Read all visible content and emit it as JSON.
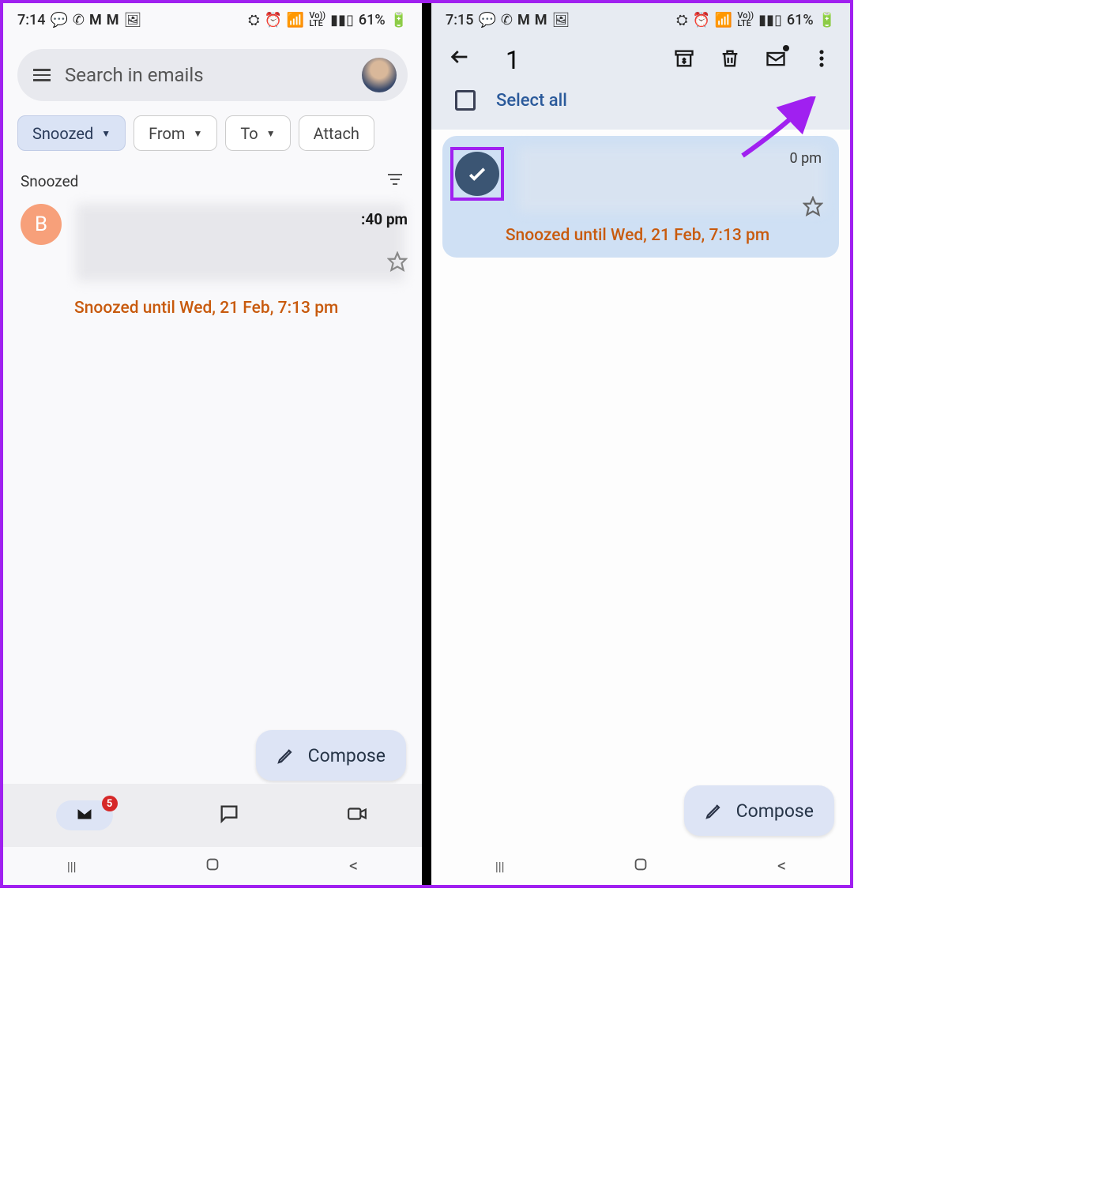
{
  "left": {
    "status": {
      "time": "7:14",
      "battery": "61%",
      "net": "Vo))\nLTE"
    },
    "search_placeholder": "Search in emails",
    "chips": {
      "snoozed": "Snoozed",
      "from": "From",
      "to": "To",
      "attachment": "Attach"
    },
    "section_label": "Snoozed",
    "email": {
      "avatar_letter": "B",
      "time": ":40 pm",
      "snooze_text": "Snoozed until Wed, 21 Feb, 7:13 pm"
    },
    "compose": "Compose",
    "badge": "5"
  },
  "right": {
    "status": {
      "time": "7:15",
      "battery": "61%",
      "net": "Vo))\nLTE"
    },
    "selected_count": "1",
    "select_all": "Select all",
    "email": {
      "time": "0 pm",
      "snooze_text": "Snoozed until Wed, 21 Feb, 7:13 pm"
    },
    "compose": "Compose"
  }
}
